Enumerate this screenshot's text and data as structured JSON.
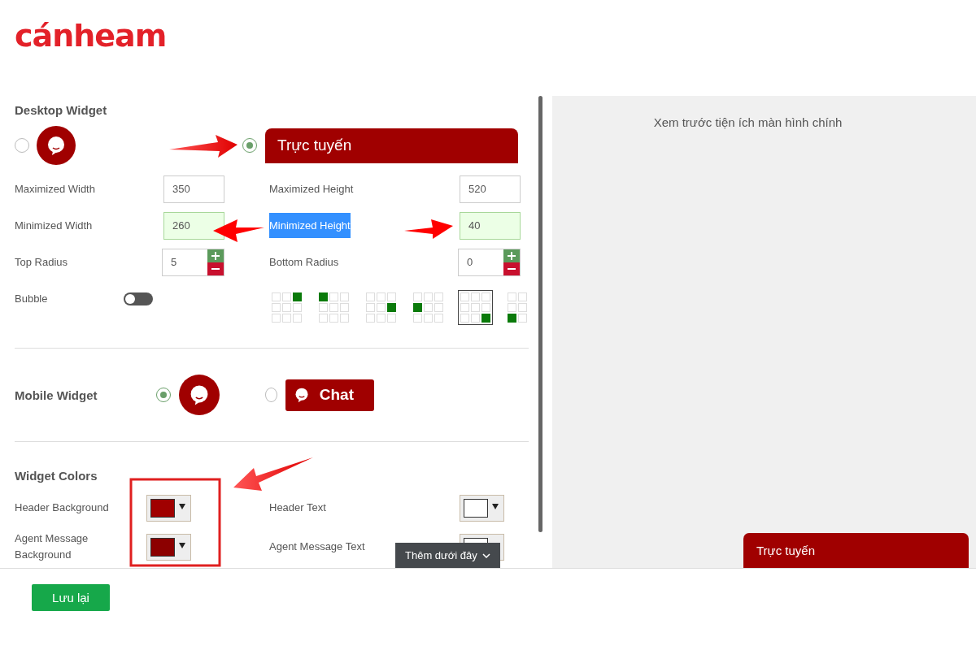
{
  "logo": {
    "text": "cánheam"
  },
  "desktop_widget": {
    "title": "Desktop Widget",
    "styles": [
      {
        "kind": "bubble",
        "selected": false
      },
      {
        "kind": "bar",
        "label": "Trực tuyến",
        "selected": true
      }
    ],
    "fields": [
      {
        "label": "Maximized Width",
        "value": "350",
        "kind": "text",
        "highlighted": false,
        "label_selected": false
      },
      {
        "label": "Maximized Height",
        "value": "520",
        "kind": "text",
        "highlighted": false,
        "label_selected": false
      },
      {
        "label": "Minimized Width",
        "value": "260",
        "kind": "text",
        "highlighted": true,
        "label_selected": false
      },
      {
        "label": "Minimized Height",
        "value": "40",
        "kind": "text",
        "highlighted": true,
        "label_selected": true
      },
      {
        "label": "Top Radius",
        "value": "5",
        "kind": "stepper",
        "highlighted": false,
        "label_selected": false
      },
      {
        "label": "Bottom Radius",
        "value": "0",
        "kind": "stepper",
        "highlighted": false,
        "label_selected": false
      }
    ],
    "bubble": {
      "label": "Bubble",
      "on": false
    },
    "positions": [
      {
        "kind": "top-right",
        "selected": false
      },
      {
        "kind": "top-left",
        "selected": false
      },
      {
        "kind": "middle-right",
        "selected": false
      },
      {
        "kind": "middle-left",
        "selected": false
      },
      {
        "kind": "bottom-right",
        "selected": true
      },
      {
        "kind": "bottom-left",
        "selected": false
      }
    ]
  },
  "mobile_widget": {
    "title": "Mobile Widget",
    "styles": [
      {
        "kind": "bubble",
        "selected": true
      },
      {
        "kind": "button",
        "label": "Chat",
        "selected": false
      }
    ]
  },
  "widget_colors": {
    "title": "Widget Colors",
    "items": [
      {
        "label": "Header Background",
        "color": "#a00000"
      },
      {
        "label": "Header Text",
        "color": "#ffffff"
      },
      {
        "label": "Agent Message Background",
        "color": "#8c0000"
      },
      {
        "label": "Agent Message Text",
        "color": "#ffffff"
      }
    ]
  },
  "tooltip": {
    "text": "Thêm dưới đây"
  },
  "preview": {
    "title": "Xem trước tiện ích màn hình chính",
    "header": "Trực tuyến"
  },
  "save_button": "Lưu lại"
}
